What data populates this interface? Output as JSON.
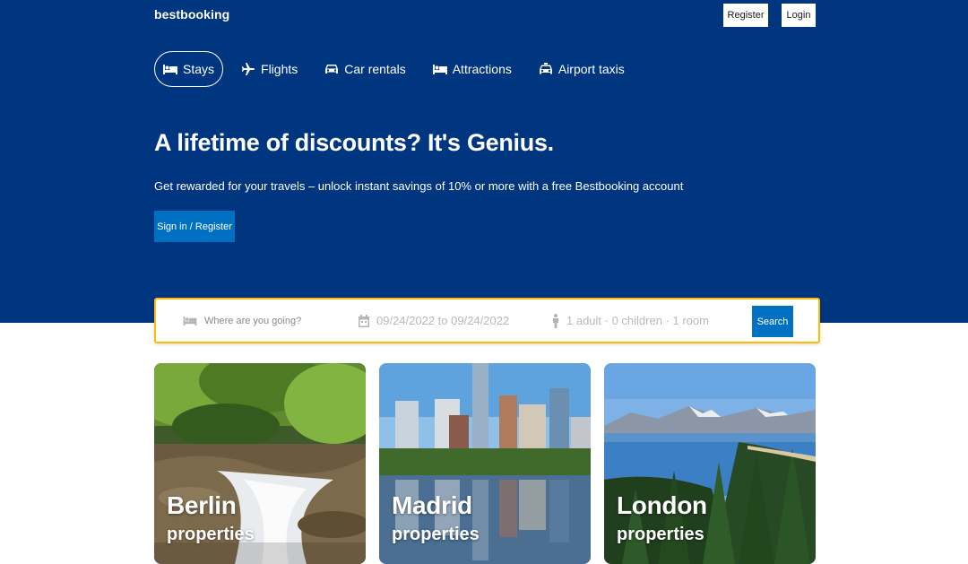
{
  "brand": "bestbooking",
  "header": {
    "register_label": "Register",
    "login_label": "Login"
  },
  "nav": [
    {
      "label": "Stays",
      "icon": "bed-icon",
      "active": true
    },
    {
      "label": "Flights",
      "icon": "plane-icon",
      "active": false
    },
    {
      "label": "Car rentals",
      "icon": "car-icon",
      "active": false
    },
    {
      "label": "Attractions",
      "icon": "attractions-icon",
      "active": false
    },
    {
      "label": "Airport taxis",
      "icon": "taxi-icon",
      "active": false
    }
  ],
  "hero": {
    "headline": "A lifetime of discounts? It's Genius.",
    "subline": "Get rewarded for your travels – unlock instant savings of 10% or more with a free Bestbooking account",
    "cta_label": "Sign in / Register"
  },
  "search": {
    "destination_placeholder": "Where are you going?",
    "dates": "09/24/2022 to 09/24/2022",
    "guests": "1 adult · 0 children · 1 room",
    "button_label": "Search"
  },
  "destinations": [
    {
      "city": "Berlin",
      "subtitle": "properties"
    },
    {
      "city": "Madrid",
      "subtitle": "properties"
    },
    {
      "city": "London",
      "subtitle": "properties"
    }
  ],
  "colors": {
    "primary": "#003580",
    "accent": "#0071c2",
    "search_border": "#febb02"
  }
}
